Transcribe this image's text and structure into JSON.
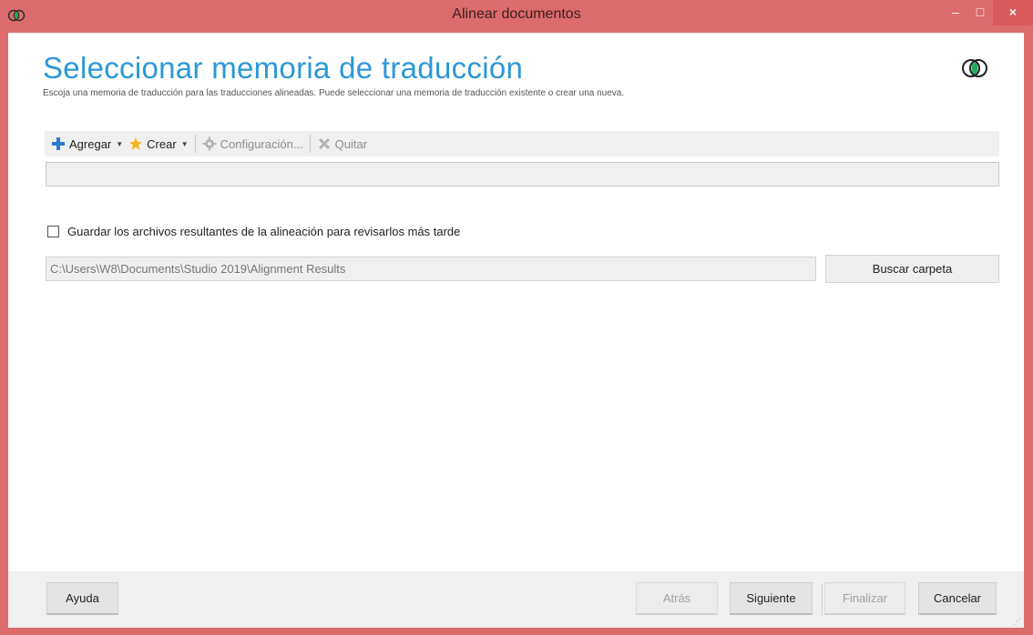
{
  "window": {
    "title": "Alinear documentos",
    "controls": {
      "minimize": "–",
      "maximize": "□",
      "close": "×"
    }
  },
  "header": {
    "title": "Seleccionar memoria de traducción",
    "subtitle": "Escoja una memoria de traducción para las traducciones alineadas. Puede seleccionar una memoria de traducción existente o crear una nueva."
  },
  "toolbar": {
    "add_label": "Agregar",
    "create_label": "Crear",
    "settings_label": "Configuración...",
    "remove_label": "Quitar"
  },
  "options": {
    "save_results_label": "Guardar los archivos resultantes de la alineación para revisarlos más tarde",
    "save_results_checked": false,
    "folder_path": "C:\\Users\\W8\\Documents\\Studio 2019\\Alignment Results",
    "browse_label": "Buscar carpeta"
  },
  "footer": {
    "help_label": "Ayuda",
    "back_label": "Atrás",
    "next_label": "Siguiente",
    "finish_label": "Finalizar",
    "cancel_label": "Cancelar"
  },
  "colors": {
    "titlebar": "#dc6b6b",
    "heading": "#2b98d5",
    "add_icon": "#2b7bd0",
    "create_icon": "#f4b41a",
    "logo_green": "#25a85a"
  },
  "icons": {
    "app": "venn-logo-icon",
    "add": "plus-icon",
    "create": "star-icon",
    "settings": "gear-icon",
    "remove": "x-icon"
  }
}
